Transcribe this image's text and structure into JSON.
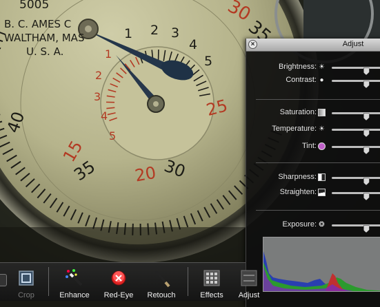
{
  "photo": {
    "dial_texts": [
      "5005",
      "B. C. AMES C",
      "WALTHAM, MAS",
      "U. S. A."
    ],
    "outer_numbers": [
      "1",
      "2",
      "3",
      "4",
      "5"
    ],
    "red_numbers": [
      "1",
      "2",
      "3",
      "4",
      "5"
    ],
    "scale_numbers": [
      "35",
      "30",
      "25",
      "20",
      "15",
      "40",
      "30",
      "35"
    ]
  },
  "adjust": {
    "title": "Adjust",
    "close_glyph": "×",
    "light": [
      {
        "label": "Brightness:",
        "icon": "brightness-icon",
        "value": 0.55
      },
      {
        "label": "Contrast:",
        "icon": "contrast-icon",
        "value": 0.55
      }
    ],
    "color": [
      {
        "label": "Saturation:",
        "icon": "saturation-icon",
        "value": 0.55
      },
      {
        "label": "Temperature:",
        "icon": "temperature-icon",
        "value": 0.55
      },
      {
        "label": "Tint:",
        "icon": "tint-icon",
        "value": 0.55
      }
    ],
    "detail": [
      {
        "label": "Sharpness:",
        "icon": "sharpness-icon",
        "value": 0.55
      },
      {
        "label": "Straighten:",
        "icon": "straighten-icon",
        "value": 0.55
      }
    ],
    "exposure": {
      "label": "Exposure:",
      "icon": "exposure-icon",
      "value": 0.55
    },
    "colors": {
      "tint_dot": "#c060c8"
    }
  },
  "toolbar": {
    "tools": [
      {
        "label": "Crop",
        "name": "crop",
        "enabled": false
      },
      {
        "label": "Enhance",
        "name": "enhance",
        "enabled": true
      },
      {
        "label": "Red-Eye",
        "name": "red-eye",
        "enabled": true
      },
      {
        "label": "Retouch",
        "name": "retouch",
        "enabled": true
      },
      {
        "label": "Effects",
        "name": "effects",
        "enabled": true
      },
      {
        "label": "Adjust",
        "name": "adjust",
        "enabled": true
      }
    ]
  }
}
